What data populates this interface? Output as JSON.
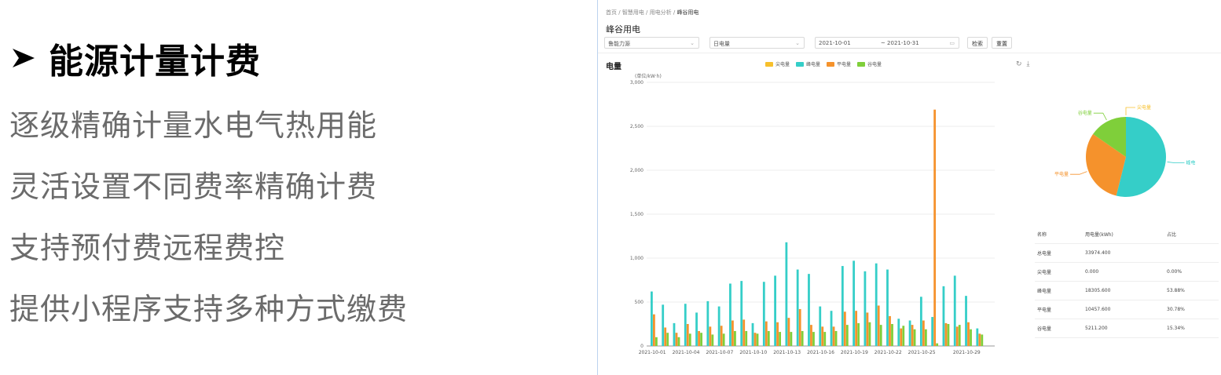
{
  "feature": {
    "title": "能源计量计费",
    "lines": [
      "逐级精确计量水电气热用能",
      "灵活设置不同费率精确计费",
      "支持预付费远程费控",
      "提供小程序支持多种方式缴费"
    ]
  },
  "app": {
    "breadcrumb": [
      "首页",
      "智慧用电",
      "用电分析",
      "峰谷用电"
    ],
    "page_title": "峰谷用电",
    "filters": {
      "building": "鲁能力源",
      "granularity": "日电量",
      "date_start": "2021-10-01",
      "date_sep": "~",
      "date_end": "2021-10-31",
      "search_label": "检索",
      "reset_label": "重置"
    },
    "chart_title": "电量",
    "unit_label": "(单位/kW·h)",
    "tools": [
      "refresh-icon",
      "download-icon"
    ],
    "table": {
      "headers": [
        "名称",
        "用电量(kWh)",
        "占比"
      ],
      "rows": [
        [
          "总电量",
          "33974.400",
          ""
        ],
        [
          "尖电量",
          "0.000",
          "0.00%"
        ],
        [
          "峰电量",
          "18305.600",
          "53.88%"
        ],
        [
          "平电量",
          "10457.600",
          "30.78%"
        ],
        [
          "谷电量",
          "5211.200",
          "15.34%"
        ]
      ]
    }
  },
  "chart_data": [
    {
      "type": "bar",
      "title": "",
      "ylabel": "(单位/kW·h)",
      "ylim": [
        0,
        3000
      ],
      "yticks": [
        0,
        500,
        1000,
        1500,
        2000,
        2500,
        3000
      ],
      "ytick_labels": [
        "0",
        "500",
        "1,000",
        "1,500",
        "2,000",
        "2,500",
        "3,000"
      ],
      "legend": "top",
      "grid": true,
      "categories": [
        "2021-10-01",
        "2021-10-02",
        "2021-10-03",
        "2021-10-04",
        "2021-10-05",
        "2021-10-06",
        "2021-10-07",
        "2021-10-08",
        "2021-10-09",
        "2021-10-10",
        "2021-10-11",
        "2021-10-12",
        "2021-10-13",
        "2021-10-14",
        "2021-10-15",
        "2021-10-16",
        "2021-10-17",
        "2021-10-18",
        "2021-10-19",
        "2021-10-20",
        "2021-10-21",
        "2021-10-22",
        "2021-10-23",
        "2021-10-24",
        "2021-10-25",
        "2021-10-26",
        "2021-10-27",
        "2021-10-28",
        "2021-10-29",
        "2021-10-30",
        "2021-10-31"
      ],
      "xtick_labels": [
        "2021-10-01",
        "",
        "",
        "2021-10-04",
        "",
        "",
        "2021-10-07",
        "",
        "",
        "2021-10-10",
        "",
        "",
        "2021-10-13",
        "",
        "",
        "2021-10-16",
        "",
        "",
        "2021-10-19",
        "",
        "",
        "2021-10-22",
        "",
        "",
        "2021-10-25",
        "",
        "",
        "",
        "2021-10-29",
        "",
        ""
      ],
      "series": [
        {
          "name": "尖电量",
          "color": "#f7c02c",
          "values": [
            0,
            0,
            0,
            0,
            0,
            0,
            0,
            0,
            0,
            0,
            0,
            0,
            0,
            0,
            0,
            0,
            0,
            0,
            0,
            0,
            0,
            0,
            0,
            0,
            0,
            0,
            0,
            0,
            0,
            0,
            0
          ]
        },
        {
          "name": "峰电量",
          "color": "#35cec8",
          "values": [
            620,
            470,
            260,
            480,
            380,
            510,
            450,
            710,
            740,
            260,
            730,
            800,
            1180,
            870,
            820,
            450,
            400,
            910,
            970,
            850,
            940,
            870,
            310,
            290,
            560,
            330,
            680,
            800,
            570,
            200,
            0
          ]
        },
        {
          "name": "平电量",
          "color": "#f5922c",
          "values": [
            360,
            210,
            150,
            250,
            170,
            220,
            230,
            290,
            300,
            150,
            280,
            270,
            320,
            420,
            240,
            220,
            220,
            390,
            400,
            380,
            460,
            340,
            200,
            240,
            290,
            2690,
            260,
            220,
            270,
            140,
            0
          ]
        },
        {
          "name": "谷电量",
          "color": "#7fcf3a",
          "values": [
            100,
            150,
            100,
            140,
            150,
            130,
            140,
            170,
            170,
            140,
            170,
            160,
            160,
            170,
            160,
            160,
            170,
            240,
            260,
            270,
            240,
            250,
            230,
            190,
            190,
            30,
            250,
            240,
            190,
            130,
            0
          ]
        }
      ]
    },
    {
      "type": "pie",
      "title": "",
      "categories": [
        "尖电量",
        "峰电量",
        "平电量",
        "谷电量"
      ],
      "values": [
        0.0,
        53.88,
        30.78,
        15.34
      ],
      "colors": [
        "#f7c02c",
        "#35cec8",
        "#f5922c",
        "#7fcf3a"
      ]
    }
  ]
}
